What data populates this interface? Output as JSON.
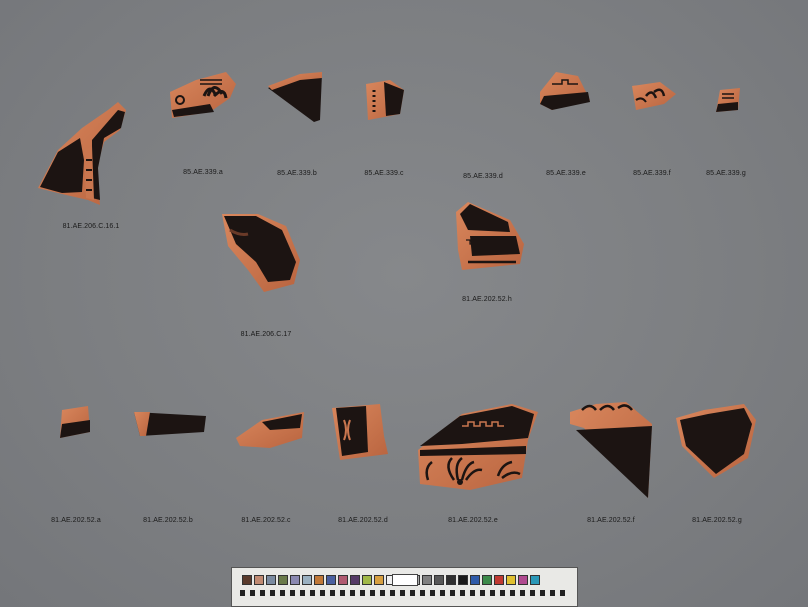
{
  "labels": [
    {
      "id": "c16-1",
      "text": "81.AE.206.C.16.1"
    },
    {
      "id": "339a",
      "text": "85.AE.339.a"
    },
    {
      "id": "339b",
      "text": "85.AE.339.b"
    },
    {
      "id": "339c",
      "text": "85.AE.339.c"
    },
    {
      "id": "339d",
      "text": "85.AE.339.d"
    },
    {
      "id": "339e",
      "text": "85.AE.339.e"
    },
    {
      "id": "339f",
      "text": "85.AE.339.f"
    },
    {
      "id": "339g",
      "text": "85.AE.339.g"
    },
    {
      "id": "c17",
      "text": "81.AE.206.C.17"
    },
    {
      "id": "52h",
      "text": "81.AE.202.52.h"
    },
    {
      "id": "52a",
      "text": "81.AE.202.52.a"
    },
    {
      "id": "52b",
      "text": "81.AE.202.52.b"
    },
    {
      "id": "52c",
      "text": "81.AE.202.52.c"
    },
    {
      "id": "52d",
      "text": "81.AE.202.52.d"
    },
    {
      "id": "52e",
      "text": "81.AE.202.52.e"
    },
    {
      "id": "52f",
      "text": "81.AE.202.52.f"
    },
    {
      "id": "52g",
      "text": "81.AE.202.52.g"
    }
  ],
  "colors": {
    "background": "#7e8083",
    "clay": "#c9764f",
    "glaze": "#1c1412",
    "label_text": "#1a1a1a"
  },
  "color_card": {
    "swatches": [
      "#5a3a2c",
      "#c08a72",
      "#7a8aa0",
      "#6a7a4a",
      "#8a88b0",
      "#9ab0c0",
      "#c07838",
      "#4a60a0",
      "#b05a70",
      "#553a66",
      "#a0b848",
      "#d8a040",
      "#f0f0f0",
      "#d0d0d0",
      "#a8a8a8",
      "#808080",
      "#585858",
      "#303030",
      "#1a1a1a",
      "#2e5aa8",
      "#3c8a4a",
      "#c03a32",
      "#e0c030",
      "#b04a90",
      "#2a98b8"
    ]
  }
}
